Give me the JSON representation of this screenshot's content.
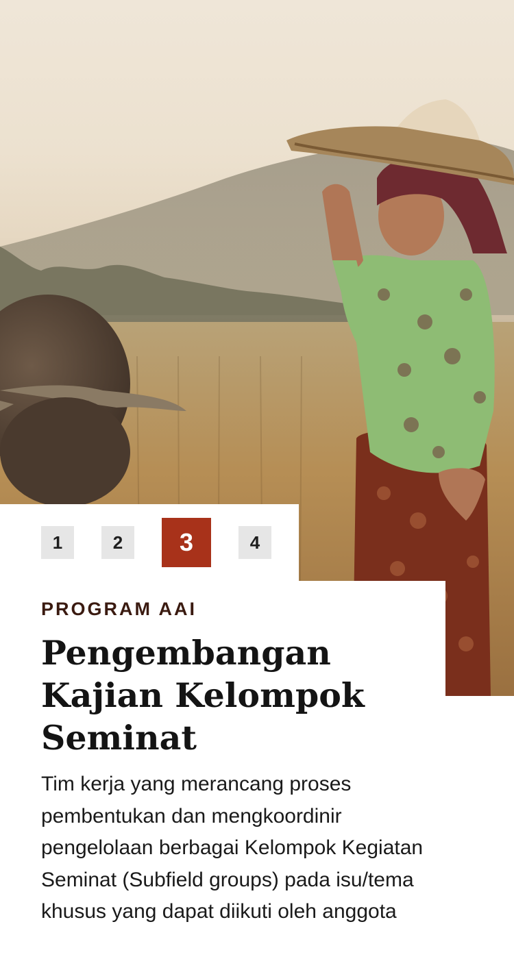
{
  "pagination": {
    "pages": [
      "1",
      "2",
      "3",
      "4"
    ],
    "active": "3"
  },
  "hero": {
    "image_description": "woman-in-rice-field-with-water-buffalo"
  },
  "article": {
    "eyebrow": "PROGRAM AAI",
    "title": "Pengembangan Kajian Kelompok Seminat",
    "description": "Tim kerja yang merancang proses pembentukan dan mengkoordinir pengelolaan berbagai Kelompok Kegiatan Seminat (Subfield groups) pada isu/tema khusus yang dapat diikuti oleh anggota"
  },
  "colors": {
    "accent": "#a8321a",
    "eyebrow": "#3a1a10",
    "page_inactive_bg": "#e6e6e6"
  }
}
